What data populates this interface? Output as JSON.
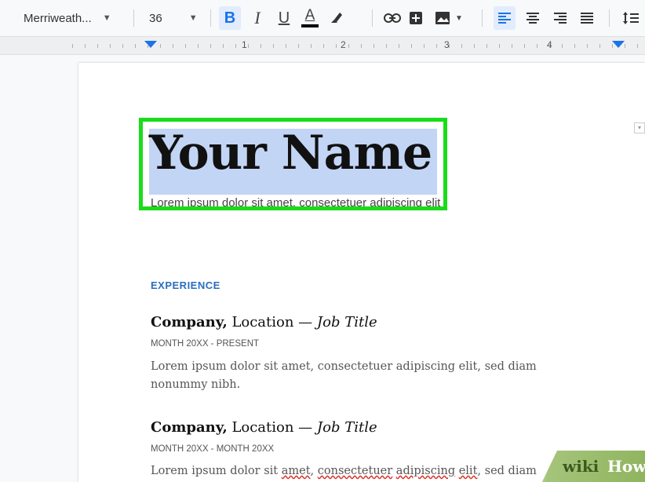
{
  "toolbar": {
    "font_name": "Merriweath...",
    "font_size": "36",
    "bold_label": "B",
    "italic_label": "I",
    "underline_label": "U",
    "text_color_label": "A"
  },
  "ruler": {
    "numbers": [
      "1",
      "2",
      "3",
      "4"
    ]
  },
  "document": {
    "name": "Your Name",
    "subtitle": "Lorem ipsum dolor sit amet, consectetuer adipiscing elit",
    "section_title": "EXPERIENCE",
    "jobs": [
      {
        "company": "Company,",
        "location": " Location — ",
        "title": "Job Title",
        "dates": "MONTH 20XX - PRESENT",
        "desc": "Lorem ipsum dolor sit amet, consectetuer adipiscing elit, sed diam nonummy nibh."
      },
      {
        "company": "Company,",
        "location": " Location — ",
        "title": "Job Title",
        "dates": "MONTH 20XX - MONTH 20XX",
        "desc_parts": [
          "Lorem ipsum dolor sit ",
          "amet",
          ", ",
          "consectetuer",
          " ",
          "adipiscing",
          " ",
          "elit",
          ", sed diam"
        ]
      }
    ]
  },
  "watermark": {
    "wiki": "wiki",
    "how": "How"
  },
  "colors": {
    "selection_box": "#1adc1a",
    "selection_highlight": "#c3d5f5",
    "section_title": "#2a6ebf",
    "active_button": "#1a73e8"
  }
}
